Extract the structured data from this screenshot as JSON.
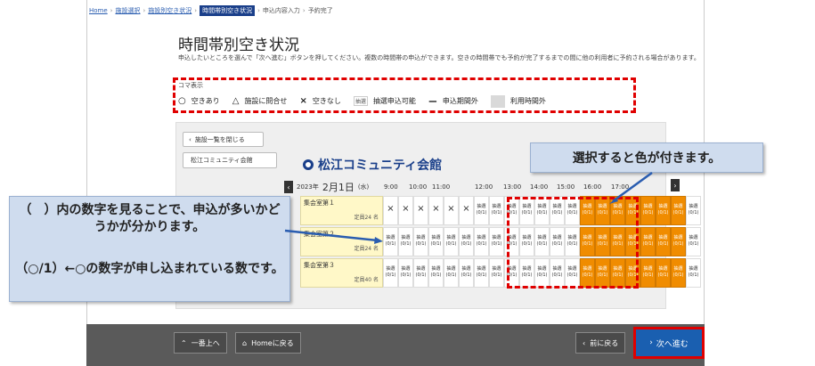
{
  "breadcrumb": {
    "items": [
      "Home",
      "施設選択",
      "施設別空き状況"
    ],
    "current": "時間帯別空き状況",
    "rest": [
      "申込内容入力",
      "予約完了"
    ]
  },
  "page_title": "時間帯別空き状況",
  "description": "申込したいところを選んで「次へ進む」ボタンを押してください。複数の時間帯の申込ができます。空きの時間帯でも予約が完了するまでの間に他の利用者に予約される場合があります。",
  "legend": {
    "title": "コマ表示",
    "items": [
      {
        "symbol": "○",
        "label": "空きあり"
      },
      {
        "symbol": "△",
        "label": "施設に問合せ"
      },
      {
        "symbol": "×",
        "label": "空きなし"
      },
      {
        "symbol": "抽選",
        "label": "抽選申込可能"
      },
      {
        "symbol": "ー",
        "label": "申込期間外"
      },
      {
        "symbol": "",
        "label": "利用時間外"
      }
    ]
  },
  "panel": {
    "close_label": "施設一覧を閉じる",
    "facility_button": "松江コミュニティ会館",
    "facility_name": "松江コミュニティ会館",
    "date_year": "2023年",
    "date_main": "2月1日",
    "date_weekday": "(水)",
    "times": [
      "9:00",
      "10:00",
      "11:00",
      "12:00",
      "13:00",
      "14:00",
      "15:00",
      "16:00",
      "17:00"
    ],
    "rooms": [
      {
        "name": "集会室第１",
        "cap": "定員24 名"
      },
      {
        "name": "集会室第２",
        "cap": "定員24 名"
      },
      {
        "name": "集会室第３",
        "cap": "定員40 名"
      }
    ],
    "slot_lottery": "抽選",
    "slot_count": "(0/1)",
    "slot_x": "×"
  },
  "callouts": {
    "top": "選択すると色が付きます。",
    "left_1": "（　）内の数字を見ることで、申込が多いかどうかが分かります。",
    "left_2": "（○/1）←○の数字が申し込まれている数です。"
  },
  "footer": {
    "top_label": "一番上へ",
    "home_label": "Homeに戻る",
    "back_label": "前に戻る",
    "next_label": "次へ進む"
  },
  "colors": {
    "selected": "#f08c00",
    "room_bg": "#fff8c8",
    "accent": "#1a3f8a",
    "highlight": "#e00000",
    "callout": "#cfdcee"
  }
}
